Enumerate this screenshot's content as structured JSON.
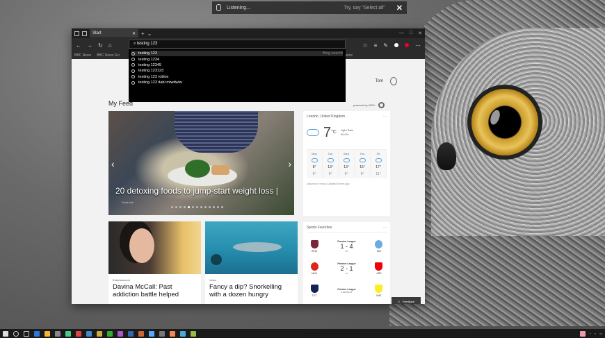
{
  "cortana": {
    "status": "Listening...",
    "hint": "Try, say \"Select all\"",
    "close": "✕"
  },
  "browser": {
    "tab_label": "Start",
    "address_value": "testing 123",
    "favorites": [
      "BBC News",
      "BBC News Sci"
    ],
    "favorites_tail": "Advance",
    "suggestions": [
      {
        "text": "testing 123",
        "meta": "Bing search"
      },
      {
        "text": "testing 1234",
        "meta": ""
      },
      {
        "text": "testing 12345",
        "meta": ""
      },
      {
        "text": "testing 123123",
        "meta": ""
      },
      {
        "text": "testing 123 roblox",
        "meta": ""
      },
      {
        "text": "testing 123 dabl mtwdwlw",
        "meta": ""
      }
    ]
  },
  "page": {
    "user_name": "Tom",
    "feed_title": "My Feed",
    "powered_by": "powered by MSN",
    "hero": {
      "title": "20 detoxing foods to jump-start weight loss |",
      "source": "Shutt-ssk"
    },
    "cards": [
      {
        "category": "Entertainment",
        "title": "Davina McCall: Past addiction battle helped"
      },
      {
        "category": "Video",
        "title": "Fancy a dip? Snorkelling with a dozen hungry"
      }
    ],
    "feedback_label": "Feedback"
  },
  "weather": {
    "location": "London, United Kingdom",
    "temp": "7",
    "unit": "°C",
    "condition": "Light Rain",
    "precip": "90.0%",
    "forecast": [
      {
        "day": "Mon",
        "hi": "8°",
        "lo": "5°"
      },
      {
        "day": "Tue",
        "hi": "13°",
        "lo": "9°"
      },
      {
        "day": "Wed",
        "hi": "13°",
        "lo": "6°"
      },
      {
        "day": "Thu",
        "hi": "15°",
        "lo": "9°"
      },
      {
        "day": "Fri",
        "hi": "17°",
        "lo": "11°"
      }
    ],
    "source": "Data from Foreca | Updated 8 mins ago"
  },
  "sports": {
    "title": "Sports Favorites",
    "matches": [
      {
        "league": "Premier League",
        "score": "1 - 4",
        "status": "FT",
        "home": "WHU",
        "away": "MCI",
        "home_color": "#7a263a",
        "away_color": "#6cabdd"
      },
      {
        "league": "Premier League",
        "score": "2 - 1",
        "status": "FT",
        "home": "MUN",
        "away": "ARS",
        "home_color": "#da291c",
        "away_color": "#ef0107"
      },
      {
        "league": "Premier League",
        "score": "3:00 PM ET",
        "status": "",
        "home": "TOT",
        "away": "WAT",
        "home_color": "#132257",
        "away_color": "#fbee23"
      }
    ]
  },
  "colors": {
    "accent": "#e03a3a",
    "weather_blue": "#5a9fd4"
  }
}
